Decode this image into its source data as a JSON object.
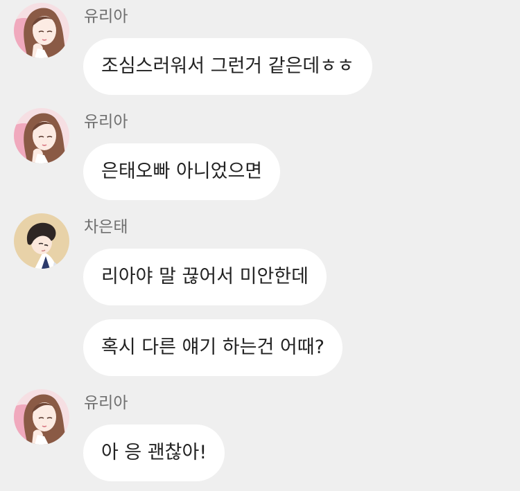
{
  "messages": [
    {
      "sender": "유리아",
      "bubbles": [
        "조심스러워서 그런거 같은데ㅎㅎ"
      ]
    },
    {
      "sender": "유리아",
      "bubbles": [
        "은태오빠 아니었으면"
      ]
    },
    {
      "sender": "차은태",
      "bubbles": [
        "리아야 말 끊어서 미안한데",
        "혹시 다른 얘기 하는건 어때?"
      ]
    },
    {
      "sender": "유리아",
      "bubbles": [
        "아 응 괜찮아!"
      ]
    }
  ],
  "avatars": {
    "yuria": "girl-avatar-icon",
    "euntae": "boy-avatar-icon"
  },
  "colors": {
    "background": "#efefef",
    "bubble": "#ffffff",
    "sender_text": "#6f6f6f",
    "message_text": "#222222"
  }
}
